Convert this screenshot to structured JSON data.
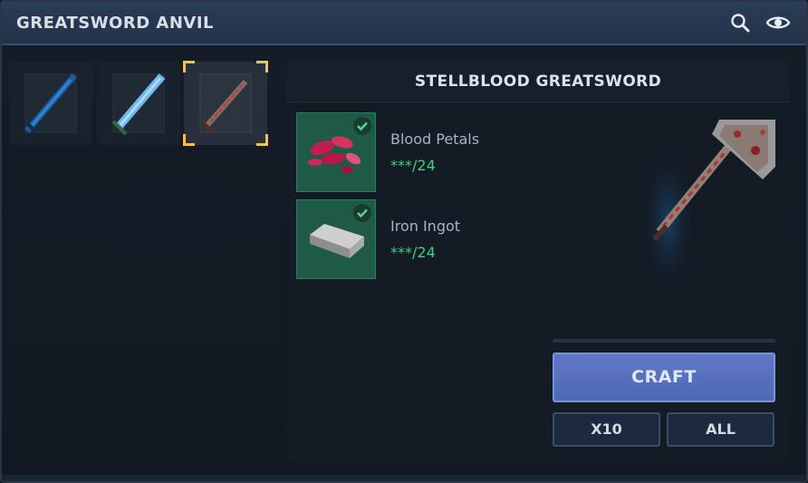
{
  "window": {
    "title": "GREATSWORD ANVIL"
  },
  "header_icons": [
    "search-icon",
    "eye-icon"
  ],
  "recipes": [
    {
      "name": "blue-greatsword",
      "selected": false
    },
    {
      "name": "ice-greatsword",
      "selected": false
    },
    {
      "name": "stellblood-greatsword",
      "selected": true
    }
  ],
  "detail": {
    "title": "STELLBLOOD GREATSWORD",
    "materials": [
      {
        "name": "Blood Petals",
        "count": "***/24",
        "icon": "blood-petals-icon"
      },
      {
        "name": "Iron Ingot",
        "count": "***/24",
        "icon": "iron-ingot-icon"
      }
    ]
  },
  "actions": {
    "craft": "CRAFT",
    "x10": "X10",
    "all": "ALL"
  },
  "colors": {
    "accent_selected": "#f2c14e",
    "ok_count": "#3ecf7c",
    "craft_button": "#5870c0"
  }
}
